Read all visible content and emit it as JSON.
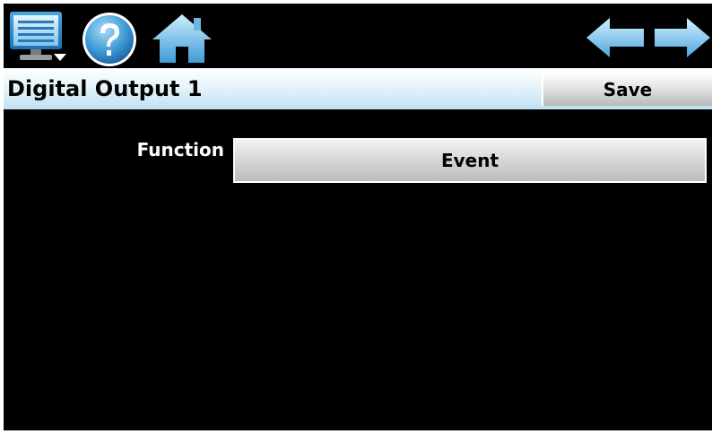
{
  "toolbar": {
    "buttons": [
      {
        "name": "menu",
        "icon": "monitor-menu-icon"
      },
      {
        "name": "help",
        "icon": "help-icon"
      },
      {
        "name": "home",
        "icon": "home-icon"
      },
      {
        "name": "back",
        "icon": "arrow-left-icon"
      },
      {
        "name": "forward",
        "icon": "arrow-right-icon"
      }
    ]
  },
  "header": {
    "title": "Digital Output 1",
    "save_label": "Save"
  },
  "form": {
    "function_label": "Function",
    "function_value": "Event"
  },
  "colors": {
    "background": "#000000",
    "titlebar_gradient_top": "#ffffff",
    "titlebar_gradient_bottom": "#bfe1f3",
    "icon_blue": "#5aaee0"
  }
}
